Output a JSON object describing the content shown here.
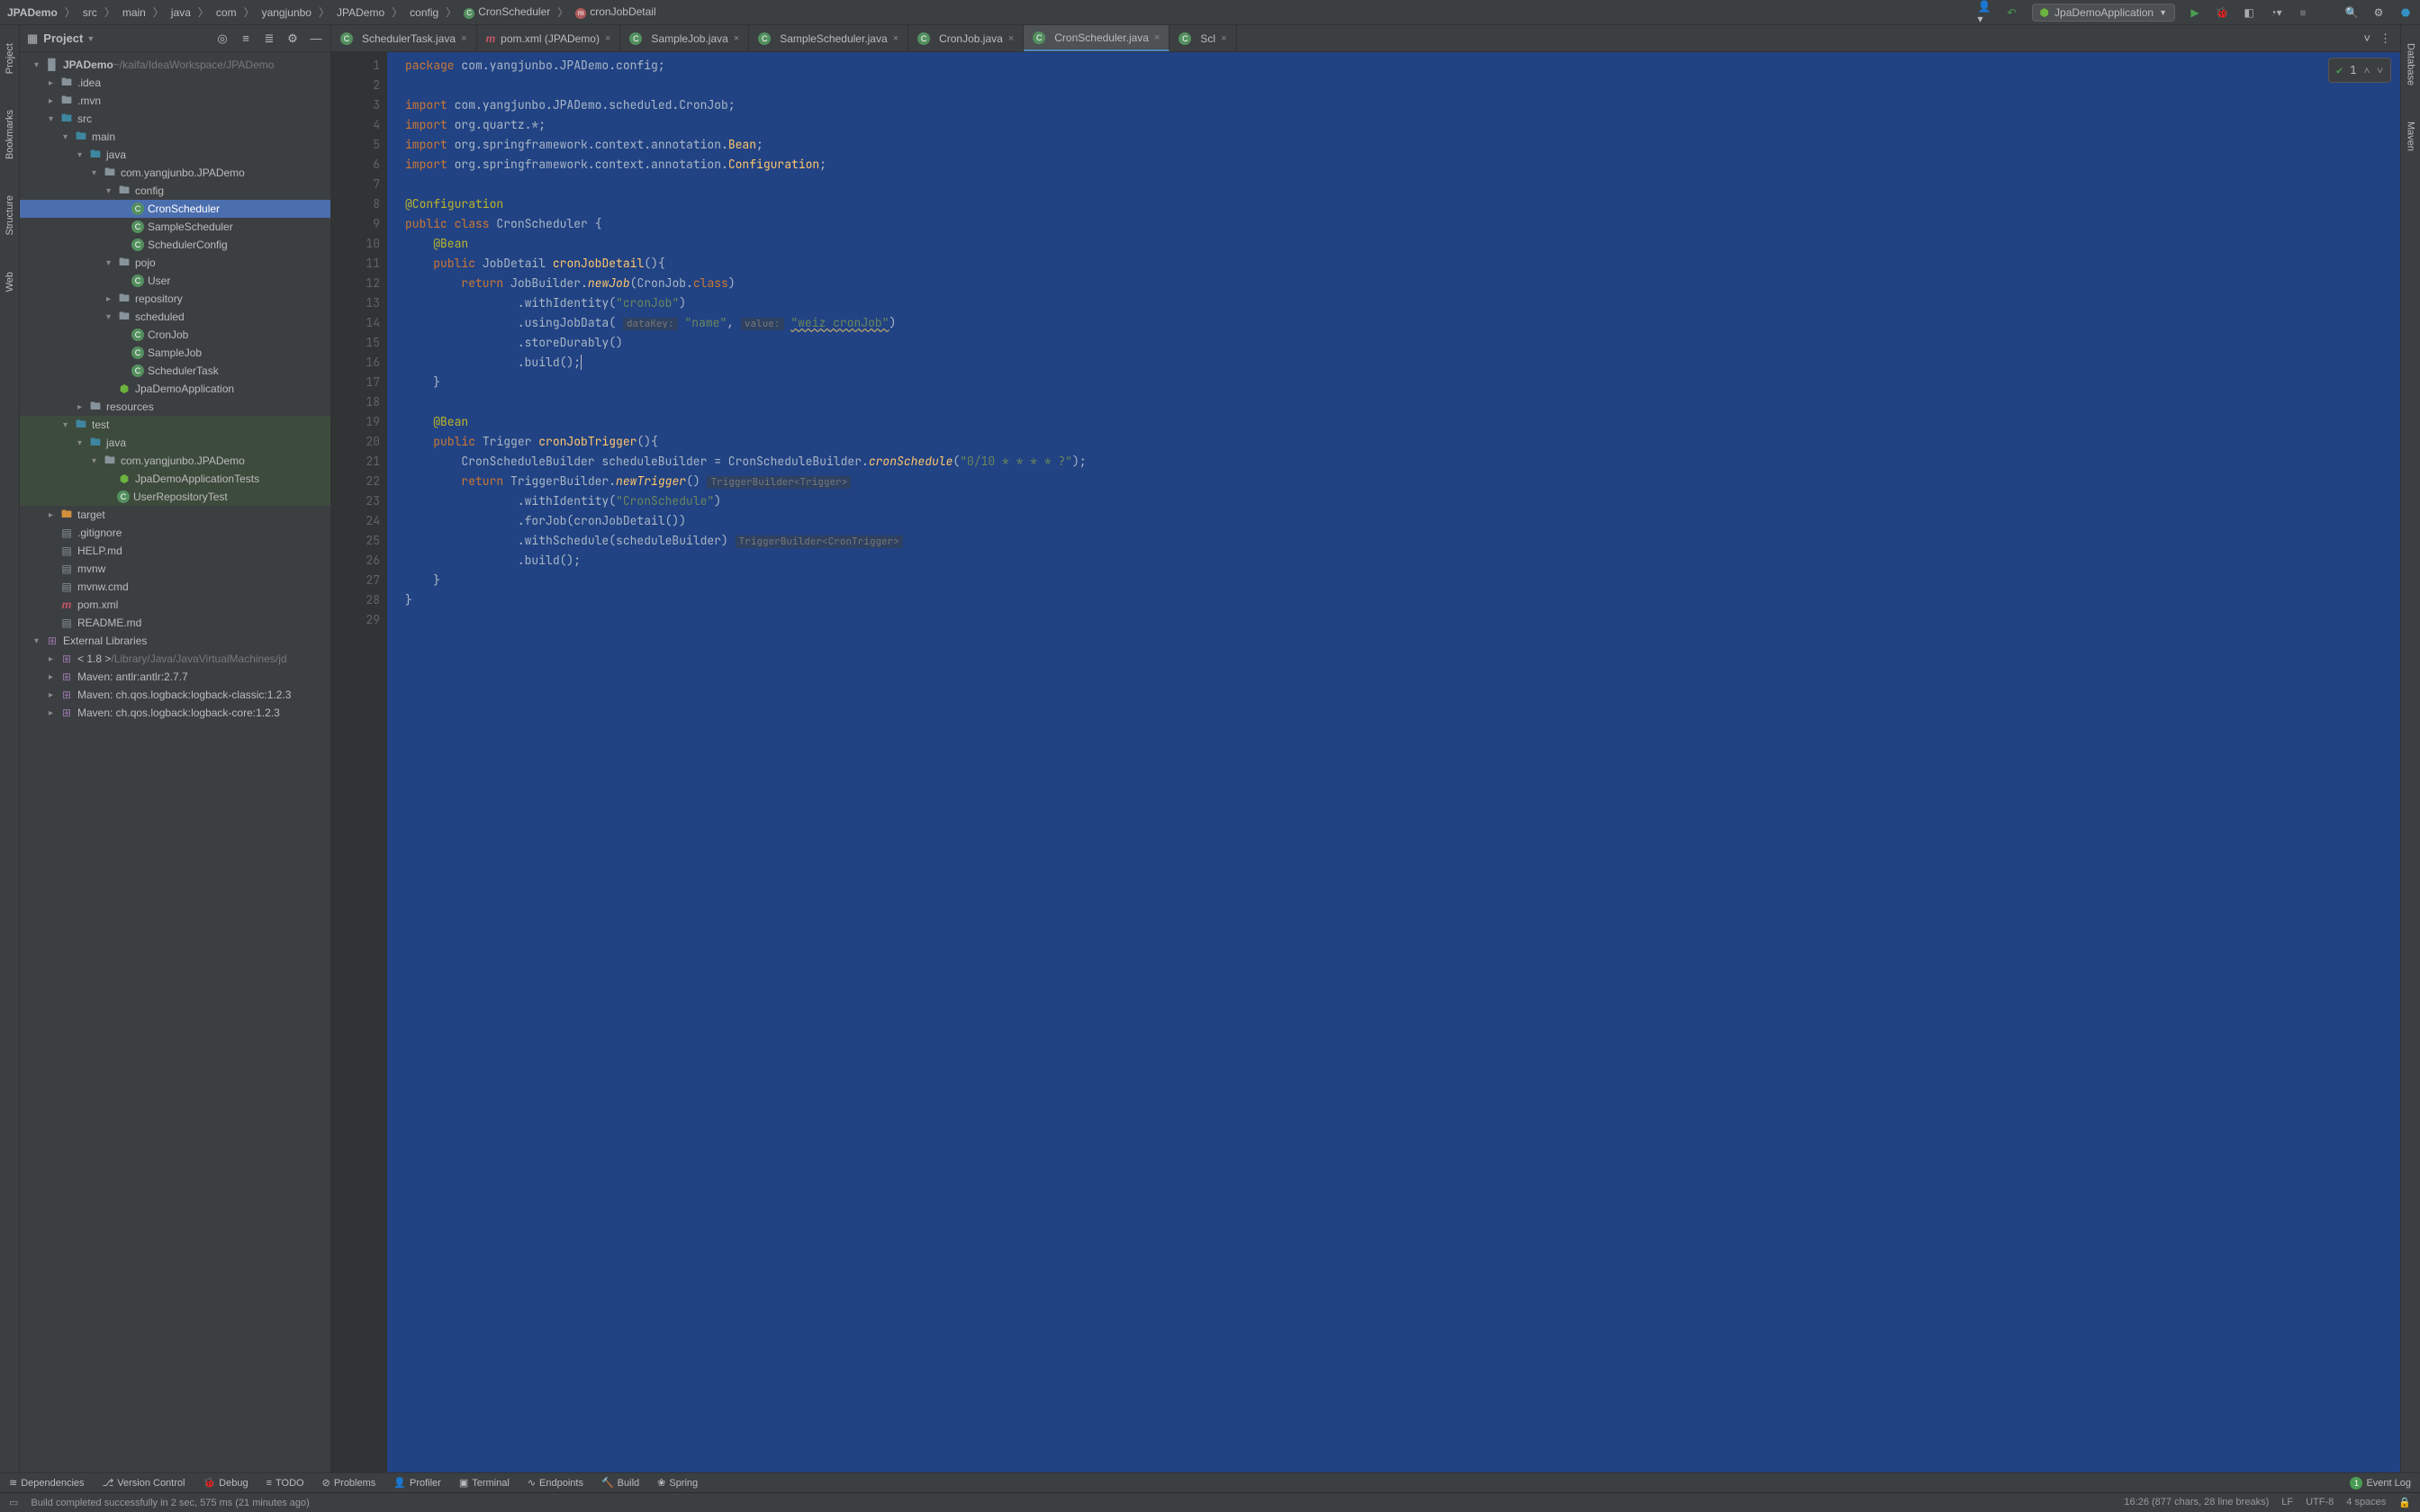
{
  "breadcrumb": [
    "JPADemo",
    "src",
    "main",
    "java",
    "com",
    "yangjunbo",
    "JPADemo",
    "config",
    "CronScheduler",
    "cronJobDetail"
  ],
  "runConfig": "JpaDemoApplication",
  "projectTitle": "Project",
  "projectRoot": {
    "name": "JPADemo",
    "path": "~/kaifa/IdeaWorkspace/JPADemo"
  },
  "tree": [
    {
      "indent": 1,
      "arrow": "▾",
      "icon": "project",
      "label": "JPADemo",
      "path": "~/kaifa/IdeaWorkspace/JPADemo",
      "bold": true
    },
    {
      "indent": 2,
      "arrow": "▸",
      "icon": "folder",
      "label": ".idea"
    },
    {
      "indent": 2,
      "arrow": "▸",
      "icon": "folder",
      "label": ".mvn"
    },
    {
      "indent": 2,
      "arrow": "▾",
      "icon": "folder-blue",
      "label": "src"
    },
    {
      "indent": 3,
      "arrow": "▾",
      "icon": "folder-blue",
      "label": "main"
    },
    {
      "indent": 4,
      "arrow": "▾",
      "icon": "folder-blue",
      "label": "java"
    },
    {
      "indent": 5,
      "arrow": "▾",
      "icon": "folder",
      "label": "com.yangjunbo.JPADemo"
    },
    {
      "indent": 6,
      "arrow": "▾",
      "icon": "folder",
      "label": "config"
    },
    {
      "indent": 7,
      "arrow": "",
      "icon": "class",
      "label": "CronScheduler",
      "selected": true
    },
    {
      "indent": 7,
      "arrow": "",
      "icon": "class",
      "label": "SampleScheduler"
    },
    {
      "indent": 7,
      "arrow": "",
      "icon": "class",
      "label": "SchedulerConfig"
    },
    {
      "indent": 6,
      "arrow": "▾",
      "icon": "folder",
      "label": "pojo"
    },
    {
      "indent": 7,
      "arrow": "",
      "icon": "class",
      "label": "User"
    },
    {
      "indent": 6,
      "arrow": "▸",
      "icon": "folder",
      "label": "repository"
    },
    {
      "indent": 6,
      "arrow": "▾",
      "icon": "folder",
      "label": "scheduled"
    },
    {
      "indent": 7,
      "arrow": "",
      "icon": "class",
      "label": "CronJob"
    },
    {
      "indent": 7,
      "arrow": "",
      "icon": "class",
      "label": "SampleJob"
    },
    {
      "indent": 7,
      "arrow": "",
      "icon": "class",
      "label": "SchedulerTask"
    },
    {
      "indent": 6,
      "arrow": "",
      "icon": "spring",
      "label": "JpaDemoApplication"
    },
    {
      "indent": 4,
      "arrow": "▸",
      "icon": "folder",
      "label": "resources"
    },
    {
      "indent": 3,
      "arrow": "▾",
      "icon": "folder-blue",
      "label": "test",
      "testbg": true
    },
    {
      "indent": 4,
      "arrow": "▾",
      "icon": "folder-blue",
      "label": "java",
      "testbg": true
    },
    {
      "indent": 5,
      "arrow": "▾",
      "icon": "folder",
      "label": "com.yangjunbo.JPADemo",
      "testbg": true
    },
    {
      "indent": 6,
      "arrow": "",
      "icon": "spring",
      "label": "JpaDemoApplicationTests",
      "testbg": true
    },
    {
      "indent": 6,
      "arrow": "",
      "icon": "class",
      "label": "UserRepositoryTest",
      "testbg": true
    },
    {
      "indent": 2,
      "arrow": "▸",
      "icon": "folder-orange",
      "label": "target"
    },
    {
      "indent": 2,
      "arrow": "",
      "icon": "file",
      "label": ".gitignore"
    },
    {
      "indent": 2,
      "arrow": "",
      "icon": "file",
      "label": "HELP.md"
    },
    {
      "indent": 2,
      "arrow": "",
      "icon": "file",
      "label": "mvnw"
    },
    {
      "indent": 2,
      "arrow": "",
      "icon": "file",
      "label": "mvnw.cmd"
    },
    {
      "indent": 2,
      "arrow": "",
      "icon": "maven",
      "label": "pom.xml"
    },
    {
      "indent": 2,
      "arrow": "",
      "icon": "file",
      "label": "README.md"
    },
    {
      "indent": 1,
      "arrow": "▾",
      "icon": "lib",
      "label": "External Libraries"
    },
    {
      "indent": 2,
      "arrow": "▸",
      "icon": "lib",
      "label": "< 1.8 >",
      "path": "/Library/Java/JavaVirtualMachines/jd"
    },
    {
      "indent": 2,
      "arrow": "▸",
      "icon": "lib",
      "label": "Maven: antlr:antlr:2.7.7"
    },
    {
      "indent": 2,
      "arrow": "▸",
      "icon": "lib",
      "label": "Maven: ch.qos.logback:logback-classic:1.2.3"
    },
    {
      "indent": 2,
      "arrow": "▸",
      "icon": "lib",
      "label": "Maven: ch.qos.logback:logback-core:1.2.3"
    }
  ],
  "tabs": [
    {
      "icon": "class",
      "label": "SchedulerTask.java"
    },
    {
      "icon": "maven",
      "label": "pom.xml (JPADemo)"
    },
    {
      "icon": "class",
      "label": "SampleJob.java"
    },
    {
      "icon": "class",
      "label": "SampleScheduler.java"
    },
    {
      "icon": "class",
      "label": "CronJob.java"
    },
    {
      "icon": "class",
      "label": "CronScheduler.java",
      "active": true
    },
    {
      "icon": "class",
      "label": "Scl"
    }
  ],
  "inspection": {
    "count": "1"
  },
  "lineCount": 29,
  "gutterIcons": {
    "9": "run",
    "13": "spring",
    "16": "bulb",
    "19": "spring"
  },
  "bottomTools": [
    "Dependencies",
    "Version Control",
    "Debug",
    "TODO",
    "Problems",
    "Profiler",
    "Terminal",
    "Endpoints",
    "Build",
    "Spring"
  ],
  "eventLog": {
    "count": "1",
    "label": "Event Log"
  },
  "statusMsg": "Build completed successfully in 2 sec, 575 ms (21 minutes ago)",
  "statusRight": [
    "16:26 (877 chars, 28 line breaks)",
    "LF",
    "UTF-8",
    "4 spaces"
  ],
  "leftStrip": [
    "Project",
    "Bookmarks",
    "Structure",
    "Web"
  ],
  "rightStrip": [
    "Database",
    "Maven"
  ]
}
